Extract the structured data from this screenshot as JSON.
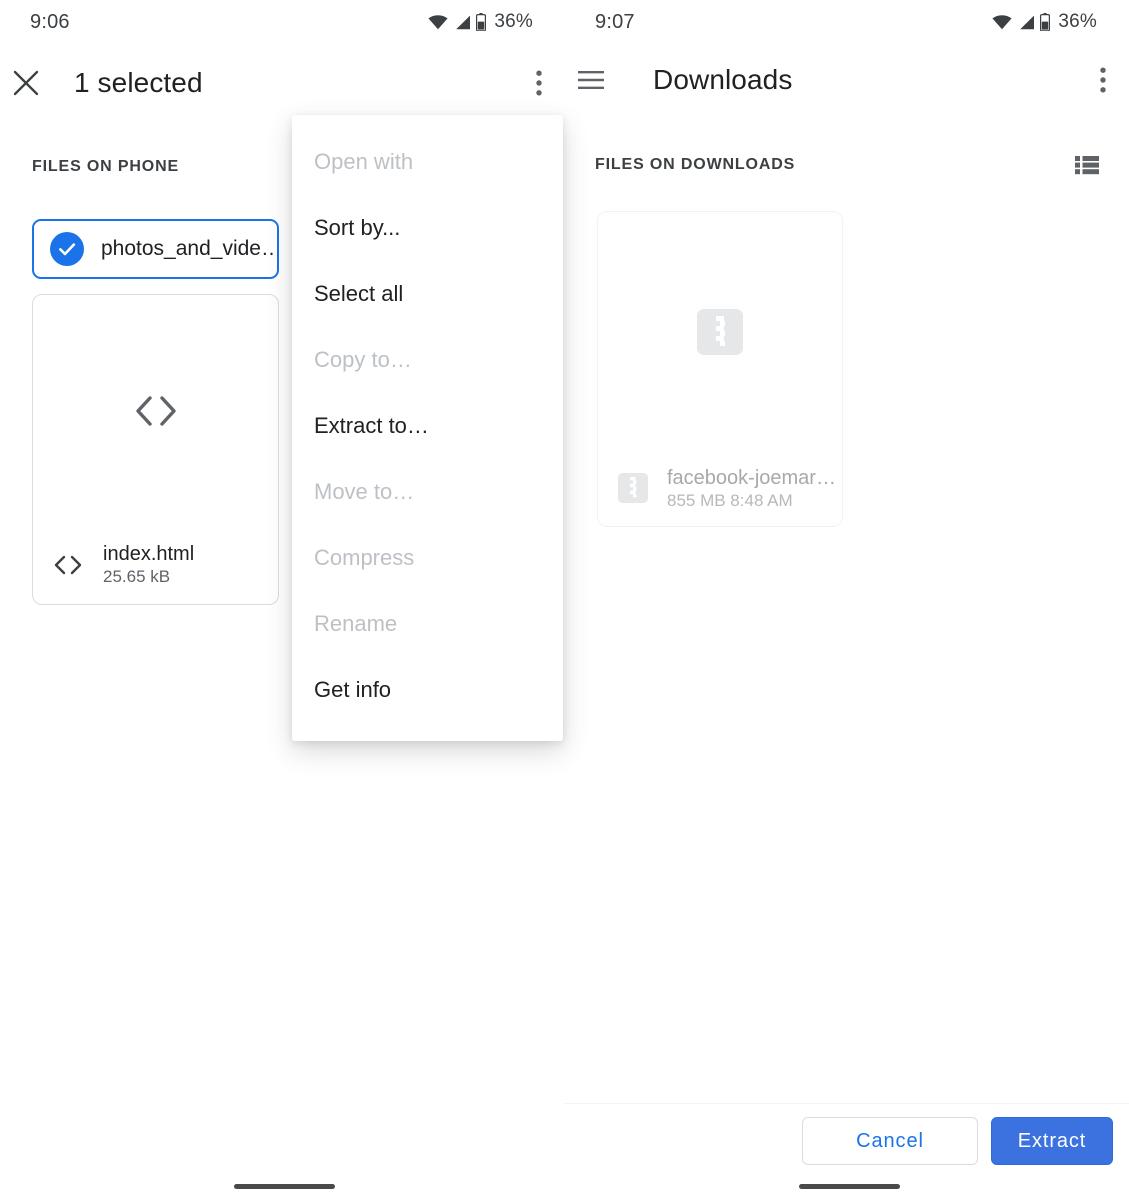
{
  "left_pane": {
    "status_bar": {
      "time": "9:06",
      "battery_percent": "36%",
      "icons": [
        "wifi-icon",
        "signal-icon",
        "battery-icon"
      ]
    },
    "app_bar": {
      "close_icon": "close-icon",
      "title": "1 selected",
      "overflow_icon": "more-vertical-icon"
    },
    "section_label": "FILES ON PHONE",
    "selected_chip": {
      "name": "photos_and_vide…",
      "checked": true,
      "accent_color": "#1a73e8"
    },
    "file_card": {
      "thumb_icon": "code-icon",
      "icon": "code-icon",
      "name": "index.html",
      "size": "25.65 kB"
    }
  },
  "menu": {
    "items": [
      {
        "label": "Open with",
        "disabled": true
      },
      {
        "label": "Sort by...",
        "disabled": false
      },
      {
        "label": "Select all",
        "disabled": false
      },
      {
        "label": "Copy to…",
        "disabled": true
      },
      {
        "label": "Extract to…",
        "disabled": false
      },
      {
        "label": "Move to…",
        "disabled": true
      },
      {
        "label": "Compress",
        "disabled": true
      },
      {
        "label": "Rename",
        "disabled": true
      },
      {
        "label": "Get info",
        "disabled": false
      }
    ]
  },
  "right_pane": {
    "status_bar": {
      "time": "9:07",
      "battery_percent": "36%",
      "icons": [
        "wifi-icon",
        "signal-icon",
        "battery-icon"
      ]
    },
    "app_bar": {
      "menu_icon": "hamburger-icon",
      "title": "Downloads",
      "overflow_icon": "more-vertical-icon"
    },
    "section_label": "FILES ON DOWNLOADS",
    "view_toggle_icon": "list-view-icon",
    "file_card": {
      "thumb_icon": "zip-icon",
      "icon": "zip-icon",
      "name": "facebook-joemar…",
      "size": "855 MB",
      "time": "8:48 AM",
      "subtitle": "855 MB 8:48 AM"
    },
    "bottom_bar": {
      "cancel_label": "Cancel",
      "extract_label": "Extract",
      "cancel_text_color": "#1a73e8",
      "extract_bg_color": "#3b72e0"
    }
  }
}
